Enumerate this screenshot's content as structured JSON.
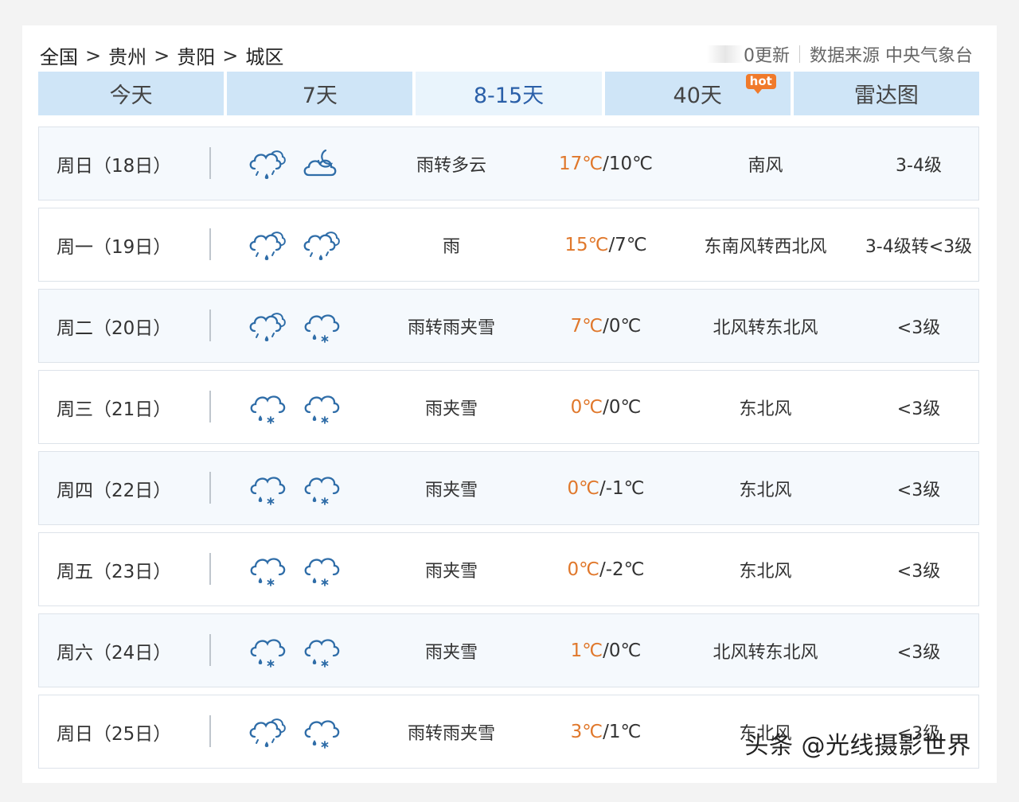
{
  "breadcrumb": [
    "全国",
    "贵州",
    "贵阳",
    "城区"
  ],
  "breadcrumb_sep": ">",
  "source": {
    "updated": "0更新",
    "label": "数据来源 中央气象台"
  },
  "tabs": [
    {
      "label": "今天"
    },
    {
      "label": "7天"
    },
    {
      "label": "8-15天",
      "active": true
    },
    {
      "label": "40天",
      "badge": "hot"
    },
    {
      "label": "雷达图"
    }
  ],
  "icon_color": "#2f6da8",
  "high_temp_color": "#e0782c",
  "rows": [
    {
      "day": "周日（18日）",
      "icons": [
        "rain-cloud-icon",
        "moon-cloud-icon"
      ],
      "condition": "雨转多云",
      "high": "17℃",
      "low": "/10℃",
      "wind": "南风",
      "level": "3-4级"
    },
    {
      "day": "周一（19日）",
      "icons": [
        "rain-cloud-icon",
        "rain-cloud-icon"
      ],
      "condition": "雨",
      "high": "15℃",
      "low": "/7℃",
      "wind": "东南风转西北风",
      "level": "3-4级转<3级"
    },
    {
      "day": "周二（20日）",
      "icons": [
        "rain-cloud-icon",
        "sleet-cloud-icon"
      ],
      "condition": "雨转雨夹雪",
      "high": "7℃",
      "low": "/0℃",
      "wind": "北风转东北风",
      "level": "<3级"
    },
    {
      "day": "周三（21日）",
      "icons": [
        "sleet-cloud-icon",
        "sleet-cloud-icon"
      ],
      "condition": "雨夹雪",
      "high": "0℃",
      "low": "/0℃",
      "wind": "东北风",
      "level": "<3级"
    },
    {
      "day": "周四（22日）",
      "icons": [
        "sleet-cloud-icon",
        "sleet-cloud-icon"
      ],
      "condition": "雨夹雪",
      "high": "0℃",
      "low": "/-1℃",
      "wind": "东北风",
      "level": "<3级"
    },
    {
      "day": "周五（23日）",
      "icons": [
        "sleet-cloud-icon",
        "sleet-cloud-icon"
      ],
      "condition": "雨夹雪",
      "high": "0℃",
      "low": "/-2℃",
      "wind": "东北风",
      "level": "<3级"
    },
    {
      "day": "周六（24日）",
      "icons": [
        "sleet-cloud-icon",
        "sleet-cloud-icon"
      ],
      "condition": "雨夹雪",
      "high": "1℃",
      "low": "/0℃",
      "wind": "北风转东北风",
      "level": "<3级"
    },
    {
      "day": "周日（25日）",
      "icons": [
        "rain-cloud-icon",
        "sleet-cloud-icon"
      ],
      "condition": "雨转雨夹雪",
      "high": "3℃",
      "low": "/1℃",
      "wind": "东北风",
      "level": "<3级"
    }
  ],
  "watermark": "头条 @光线摄影世界"
}
